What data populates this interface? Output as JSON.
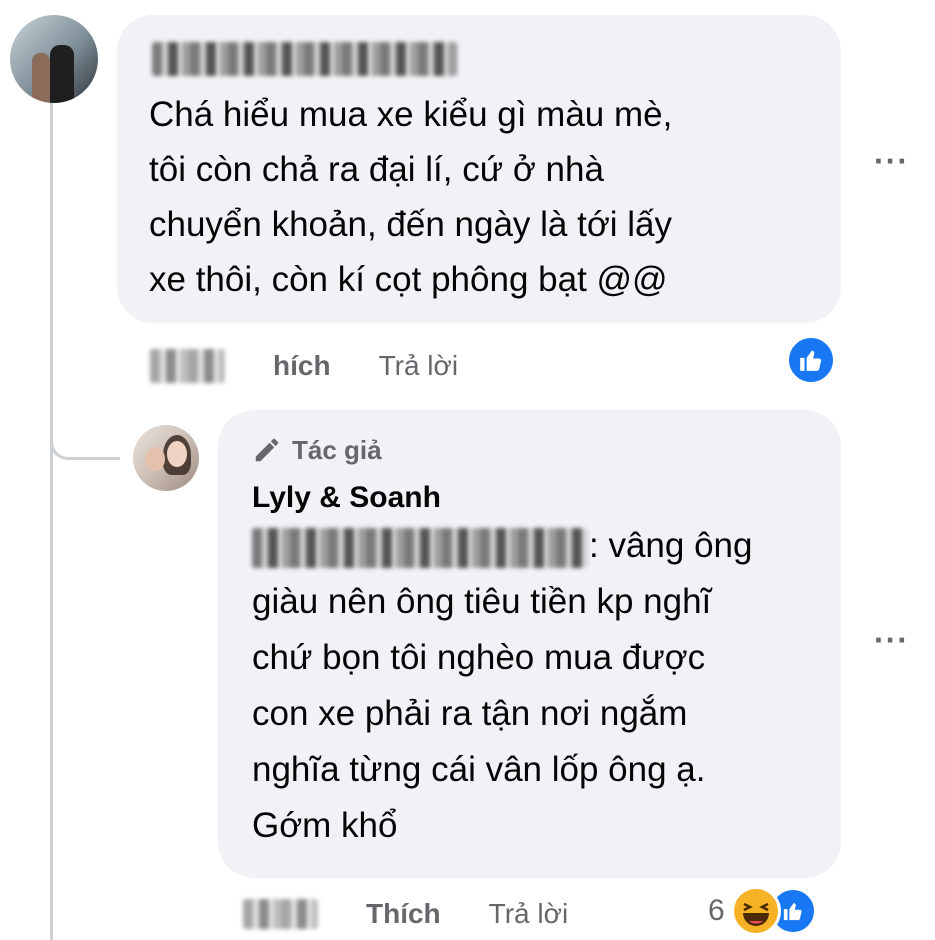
{
  "comment1": {
    "text_lines": [
      "Chá hiểu mua xe kiểu gì màu mè,",
      "tôi còn chả ra đại lí, cứ ở nhà",
      "chuyển khoản, đến ngày là tới lấy",
      "xe thôi, còn kí cọt phông bạt @@"
    ],
    "like_label": "hích",
    "reply_label": "Trả lời",
    "more_label": "···"
  },
  "comment2": {
    "author_badge": "Tác giả",
    "author_name": "Lyly & Soanh",
    "text_first": ": vâng ông",
    "text_lines": [
      "giàu nên ông tiêu tiền kp nghĩ",
      "chứ bọn tôi nghèo mua được",
      "con xe phải ra tận nơi ngắm",
      "nghĩa từng cái vân lốp ông ạ.",
      "Gớm khổ"
    ],
    "like_label": "Thích",
    "reply_label": "Trả lời",
    "reaction_count": "6",
    "more_label": "···"
  },
  "colors": {
    "bubble_bg": "#f0f2f5",
    "meta_text": "#65676b",
    "like_blue": "#1877f2",
    "haha_yellow": "#f7b125"
  },
  "icons": [
    "pen-icon",
    "like-icon",
    "haha-icon",
    "more-icon"
  ]
}
